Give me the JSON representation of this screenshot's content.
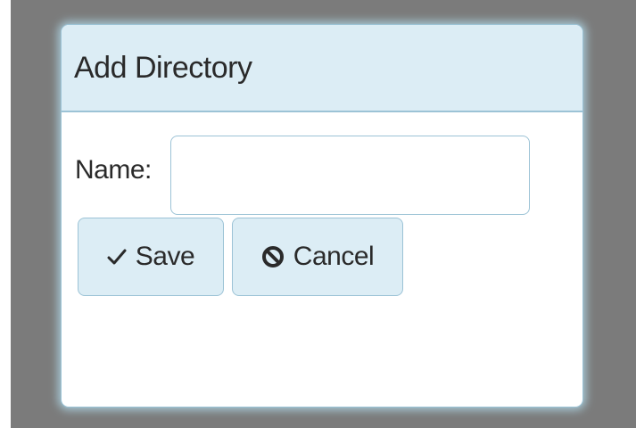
{
  "dialog": {
    "title": "Add Directory",
    "name_label": "Name:",
    "name_value": "",
    "name_placeholder": "",
    "save_label": "Save",
    "save_icon": "check-icon",
    "cancel_label": "Cancel",
    "cancel_icon": "ban-icon"
  },
  "colors": {
    "backdrop": "#7b7b7b",
    "header_bg": "#dcedf5",
    "border": "#9cc3d6",
    "button_bg": "#dcedf5",
    "text": "#2a2a2a"
  }
}
